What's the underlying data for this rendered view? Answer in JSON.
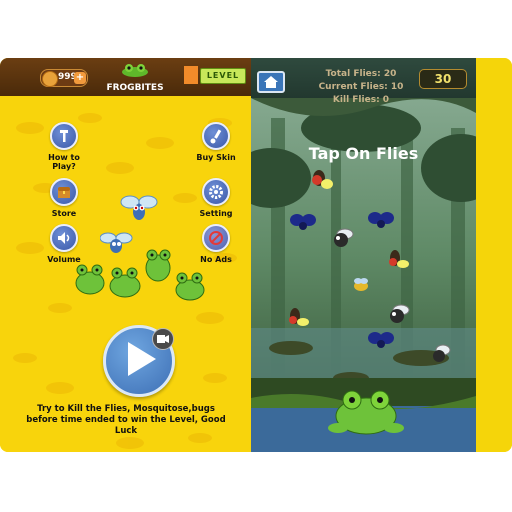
{
  "left_panel": {
    "coins": "999",
    "coin_plus": "+",
    "brand_name": "FROGBITES",
    "level_label": "LEVEL",
    "menu": [
      {
        "label_line1": "How to",
        "label_line2": "Play?",
        "icon": "wrench-icon"
      },
      {
        "label_line1": "Buy Skin",
        "label_line2": "",
        "icon": "brush-icon"
      },
      {
        "label_line1": "Store",
        "label_line2": "",
        "icon": "treasure-chest-icon"
      },
      {
        "label_line1": "Setting",
        "label_line2": "",
        "icon": "gear-icon"
      },
      {
        "label_line1": "Volume",
        "label_line2": "",
        "icon": "speaker-icon"
      },
      {
        "label_line1": "No Ads",
        "label_line2": "",
        "icon": "no-ads-icon"
      }
    ],
    "description": "Try to Kill the Flies, Mosquitose,bugs before time ended to win the Level, Good Luck"
  },
  "right_panel": {
    "total_flies": "Total Flies: 20",
    "current_flies": "Current Flies: 10",
    "kill_flies": "Kill Flies: 0",
    "timer": "30",
    "title": "Tap On Flies"
  },
  "colors": {
    "yellow_bg": "#f8d40c",
    "menu_blue": "#3b58a8",
    "topbar_brown": "#4a2a0a",
    "game_topbar": "#22382f"
  }
}
